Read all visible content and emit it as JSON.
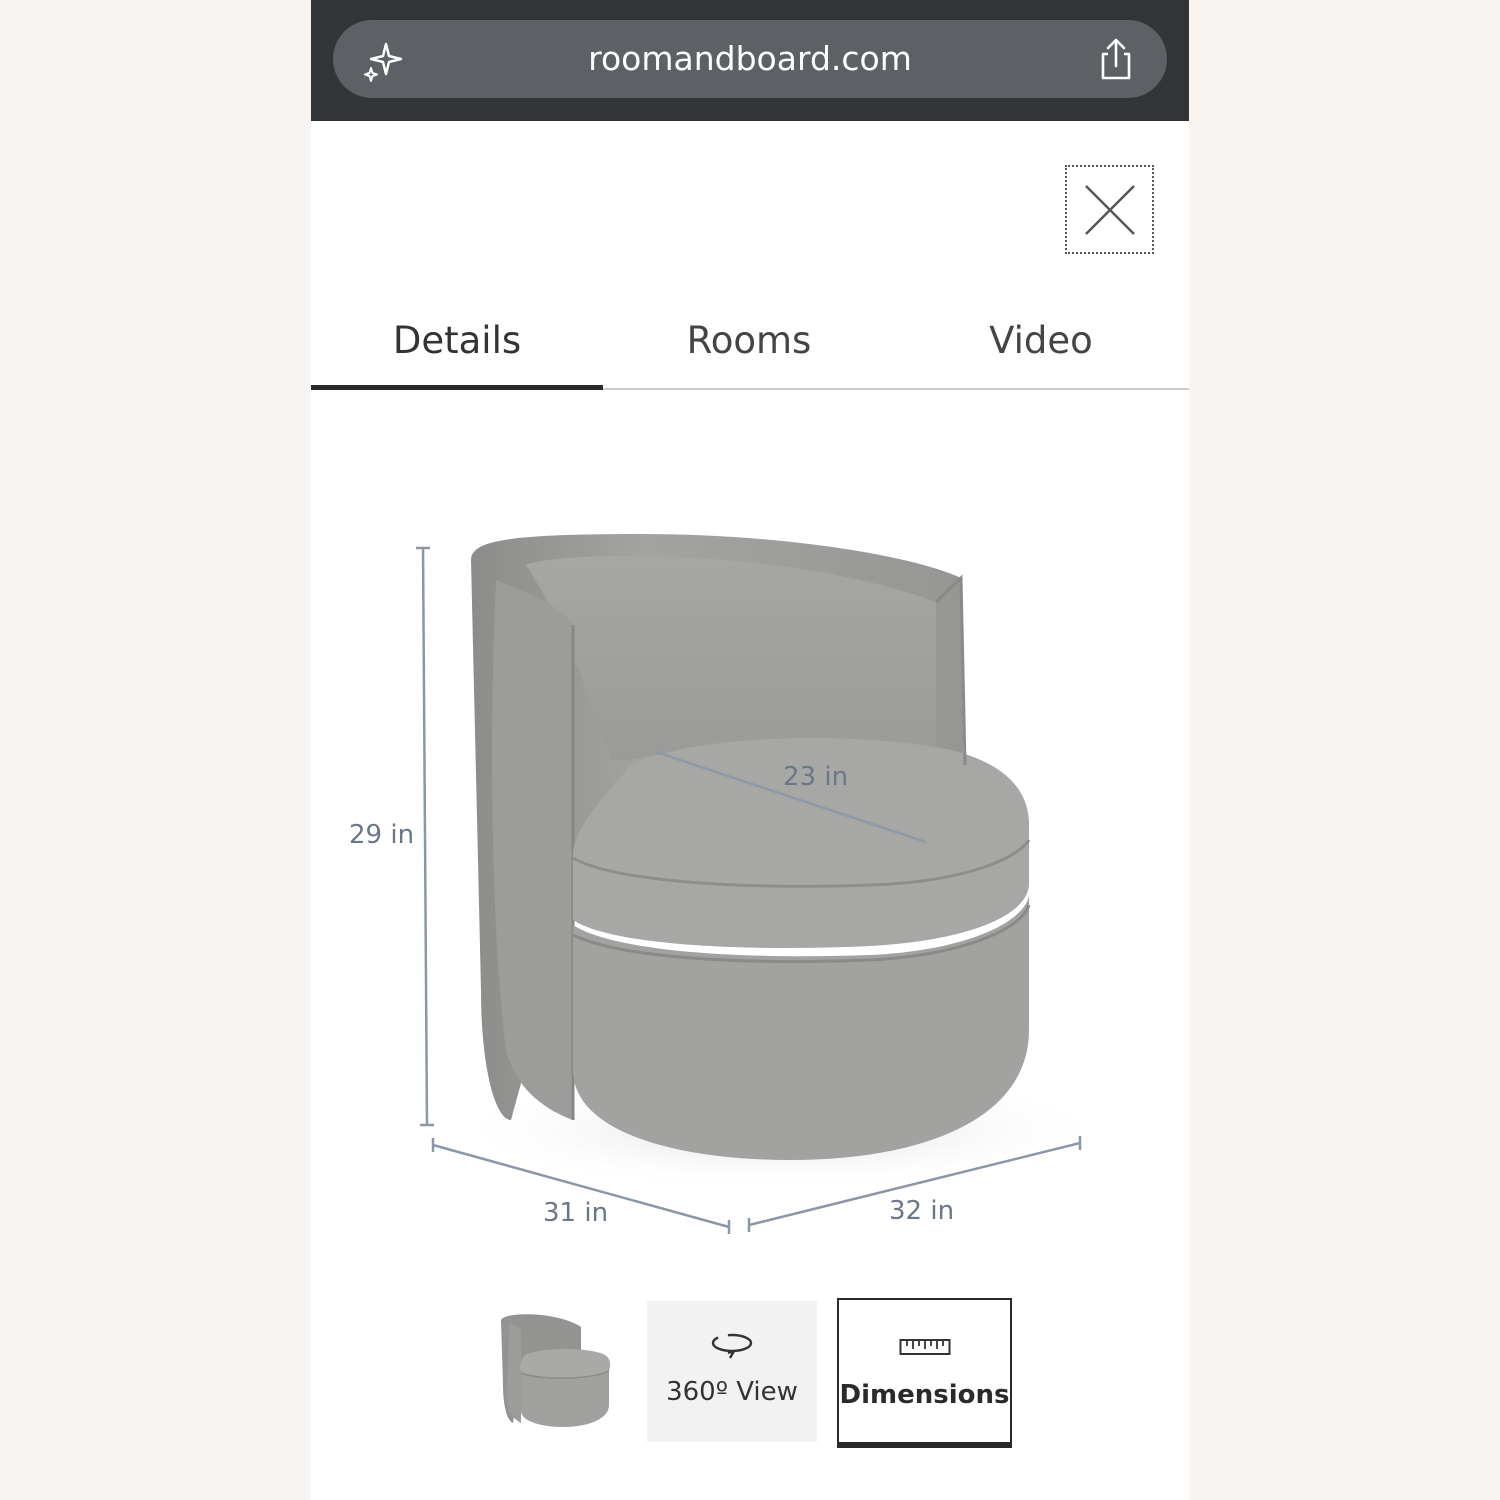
{
  "browser": {
    "url": "roomandboard.com",
    "left_icon": "sparkle-icon",
    "right_icon": "share-icon"
  },
  "modal": {
    "close_icon": "close-icon"
  },
  "tabs": [
    {
      "label": "Details",
      "active": true
    },
    {
      "label": "Rooms",
      "active": false
    },
    {
      "label": "Video",
      "active": false
    }
  ],
  "dimensions": {
    "height": "29 in",
    "seat_depth": "23 in",
    "width": "31 in",
    "depth": "32 in"
  },
  "thumbnails": [
    {
      "kind": "photo",
      "label": ""
    },
    {
      "kind": "360",
      "label": "360º View",
      "icon": "rotate-360-icon"
    },
    {
      "kind": "dimensions",
      "label": "Dimensions",
      "icon": "ruler-icon",
      "active": true
    }
  ],
  "colors": {
    "fabric": "#9a9a98",
    "dimension_line": "#8a97a8",
    "browser_bar": "#333436",
    "url_pill": "#5d6064"
  }
}
